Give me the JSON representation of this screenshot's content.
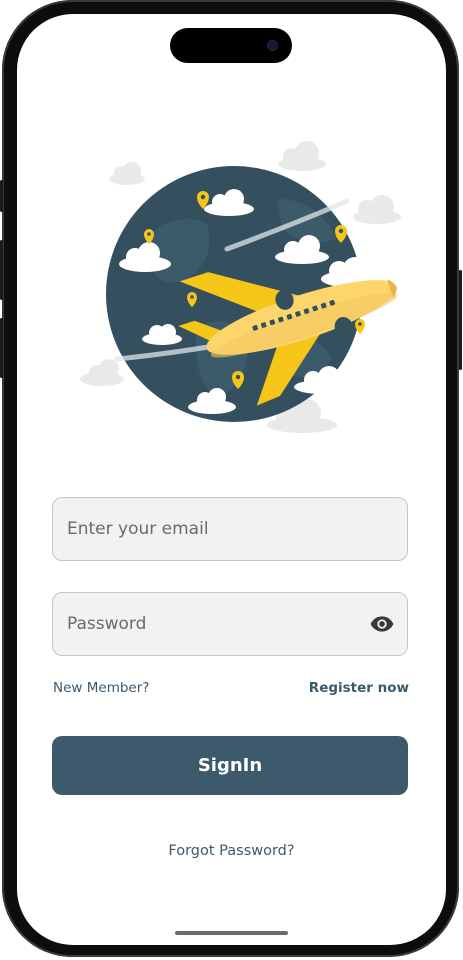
{
  "login": {
    "email_placeholder": "Enter your email",
    "password_placeholder": "Password",
    "new_member_label": "New Member?",
    "register_label": "Register now",
    "signin_label": "SignIn",
    "forgot_label": "Forgot Password?"
  },
  "icons": {
    "password_toggle": "eye-icon",
    "hero": "globe-airplane-illustration"
  },
  "colors": {
    "primary": "#3d5a6c",
    "field_background": "#f2f2f2",
    "globe": "#34505f",
    "airplane": "#fcd56b",
    "airplane_accent": "#f5c518"
  }
}
